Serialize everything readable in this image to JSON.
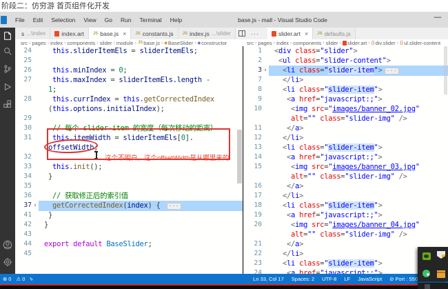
{
  "desktop": {
    "top_text": "阶段二：仿穷游 首页组件化开发"
  },
  "menu_bar": {
    "items": [
      "File",
      "Edit",
      "Selection",
      "View",
      "Go",
      "Run",
      "Terminal",
      "Help"
    ],
    "window_title": "base.js - mall - Visual Studio Code",
    "minimize_label": "—"
  },
  "tab_bar": {
    "left_tabs": [
      {
        "label": "s",
        "dir": "...\\index",
        "icon": "none",
        "state": "inactive"
      },
      {
        "label": "index.art",
        "icon": "art",
        "state": "inactive"
      },
      {
        "label": "base.js",
        "icon": "js",
        "state": "active",
        "close": "×"
      },
      {
        "label": "constants.js",
        "icon": "js",
        "state": "inactive"
      },
      {
        "label": "index.js",
        "dir": "...\\slider",
        "icon": "js",
        "state": "inactive"
      }
    ],
    "actions": {
      "more": "···"
    },
    "right_tabs": [
      {
        "label": "slider.art",
        "icon": "art",
        "state": "active",
        "close": "×"
      },
      {
        "label": "defaults.js",
        "icon": "js",
        "state": "inactive",
        "dim": true
      }
    ]
  },
  "breadcrumbs": {
    "left": [
      {
        "label": "src"
      },
      {
        "label": "pages"
      },
      {
        "label": "index"
      },
      {
        "label": "components"
      },
      {
        "label": "slider"
      },
      {
        "label": "module"
      },
      {
        "label": "base.js",
        "icon": "js"
      },
      {
        "label": "BaseSlider",
        "icon": "cls"
      },
      {
        "label": "constructor",
        "icon": "meth"
      }
    ],
    "right": [
      {
        "label": "src"
      },
      {
        "label": "pages"
      },
      {
        "label": "index"
      },
      {
        "label": "components"
      },
      {
        "label": "slider"
      },
      {
        "label": "slider.art",
        "icon": "art"
      },
      {
        "label": "div.slider",
        "icon": "tag"
      },
      {
        "label": "ul.slider-content",
        "icon": "tag"
      }
    ]
  },
  "editor_left": {
    "rows": [
      {
        "n": "24",
        "i": 2,
        "t": [
          [
            "k",
            "this"
          ],
          [
            "p",
            ".sliderItemEls"
          ],
          [
            "o",
            " = "
          ],
          [
            "v",
            "sliderItemEls"
          ],
          [
            "o",
            ";"
          ]
        ]
      },
      {
        "n": "25"
      },
      {
        "n": "26",
        "i": 2,
        "t": [
          [
            "k",
            "this"
          ],
          [
            "p",
            ".minIndex"
          ],
          [
            "o",
            " = "
          ],
          [
            "num",
            "0"
          ],
          [
            "o",
            ";"
          ]
        ]
      },
      {
        "n": "27",
        "i": 2,
        "t": [
          [
            "k",
            "this"
          ],
          [
            "p",
            ".maxIndex"
          ],
          [
            "o",
            " = "
          ],
          [
            "v",
            "sliderItemEls"
          ],
          [
            "p",
            ".length"
          ],
          [
            "o",
            " -"
          ]
        ]
      },
      {
        "n": "",
        "i": 1,
        "t": [
          [
            "num",
            "1"
          ],
          [
            "o",
            ";"
          ]
        ]
      },
      {
        "n": "28",
        "i": 2,
        "t": [
          [
            "k",
            "this"
          ],
          [
            "p",
            ".currIndex"
          ],
          [
            "o",
            " = "
          ],
          [
            "k",
            "this"
          ],
          [
            "o",
            "."
          ],
          [
            "f",
            "getCorrectedIndex"
          ]
        ]
      },
      {
        "n": "",
        "i": 1,
        "t": [
          [
            "o",
            "("
          ],
          [
            "k",
            "this"
          ],
          [
            "p",
            ".options.initialIndex"
          ],
          [
            "o",
            ");"
          ]
        ]
      },
      {
        "n": "29"
      },
      {
        "n": "30",
        "i": 2,
        "t": [
          [
            "c",
            "// 每个 slider-item 的宽度（每次移动的距离）"
          ]
        ]
      },
      {
        "n": "31",
        "i": 2,
        "t": [
          [
            "k",
            "this"
          ],
          [
            "p",
            ".itemWidth"
          ],
          [
            "o",
            " = "
          ],
          [
            "v",
            "sliderItemEls"
          ],
          [
            "o",
            "["
          ],
          [
            "num",
            "0"
          ],
          [
            "o",
            "]."
          ]
        ]
      },
      {
        "n": "",
        "i": 1,
        "t": [
          [
            "p",
            "offsetWidth"
          ],
          [
            "o",
            ";"
          ]
        ]
      },
      {
        "n": "32"
      },
      {
        "n": "33",
        "i": 2,
        "t": [
          [
            "k",
            "this"
          ],
          [
            "o",
            "."
          ],
          [
            "f",
            "init"
          ],
          [
            "o",
            "();"
          ]
        ]
      },
      {
        "n": "34",
        "i": 1,
        "t": [
          [
            "o",
            "}"
          ]
        ]
      },
      {
        "n": "35"
      },
      {
        "n": "36",
        "i": 2,
        "t": [
          [
            "c",
            "// 获取修正后的索引值"
          ]
        ]
      },
      {
        "n": "37",
        "i": 2,
        "hl": true,
        "fold": true,
        "t": [
          [
            "f",
            "getCorrectedIndex"
          ],
          [
            "o",
            "("
          ],
          [
            "v",
            "index"
          ],
          [
            "o",
            ") { "
          ],
          [
            "fd",
            "···"
          ]
        ]
      },
      {
        "n": "41",
        "i": 1,
        "t": [
          [
            "o",
            "}"
          ]
        ]
      },
      {
        "n": "42",
        "i": 0,
        "t": [
          [
            "o",
            "}"
          ]
        ]
      },
      {
        "n": "43"
      },
      {
        "n": "44",
        "i": 0,
        "t": [
          [
            "pk",
            "export"
          ],
          [
            "o",
            " "
          ],
          [
            "pk",
            "default"
          ],
          [
            "o",
            " "
          ],
          [
            "cl",
            "BaseSlider"
          ],
          [
            "o",
            ";"
          ]
        ]
      },
      {
        "n": "45"
      }
    ]
  },
  "editor_right": {
    "rows": [
      {
        "n": "1",
        "i": 0,
        "t": [
          [
            "b",
            "<"
          ],
          [
            "tag",
            "div"
          ],
          [
            "o",
            " "
          ],
          [
            "at",
            "class"
          ],
          [
            "o",
            "="
          ],
          [
            "str",
            "\"slider\""
          ],
          [
            "b",
            ">"
          ]
        ]
      },
      {
        "n": "2",
        "i": 1,
        "t": [
          [
            "b",
            "<"
          ],
          [
            "tag",
            "ul"
          ],
          [
            "o",
            " "
          ],
          [
            "at",
            "class"
          ],
          [
            "o",
            "="
          ],
          [
            "str",
            "\"slider-content\""
          ],
          [
            "b",
            ">"
          ]
        ]
      },
      {
        "n": "3",
        "i": 2,
        "hl": true,
        "fold": true,
        "t": [
          [
            "b",
            "<"
          ],
          [
            "tag",
            "li"
          ],
          [
            "o",
            " "
          ],
          [
            "at",
            "class"
          ],
          [
            "o",
            "="
          ],
          [
            "str",
            "\""
          ],
          [
            "wh",
            "slider-item"
          ],
          [
            "str",
            "\""
          ],
          [
            "b",
            ">"
          ],
          [
            "fd",
            "···"
          ]
        ]
      },
      {
        "n": "7",
        "i": 2,
        "t": [
          [
            "b",
            "</"
          ],
          [
            "tag",
            "li"
          ],
          [
            "b",
            ">"
          ]
        ]
      },
      {
        "n": "8",
        "i": 2,
        "t": [
          [
            "b",
            "<"
          ],
          [
            "tag",
            "li"
          ],
          [
            "o",
            " "
          ],
          [
            "at",
            "class"
          ],
          [
            "o",
            "="
          ],
          [
            "str",
            "\""
          ],
          [
            "wh",
            "slider-item"
          ],
          [
            "str",
            "\""
          ],
          [
            "b",
            ">"
          ]
        ]
      },
      {
        "n": "9",
        "i": 3,
        "t": [
          [
            "b",
            "<"
          ],
          [
            "tag",
            "a"
          ],
          [
            "o",
            " "
          ],
          [
            "at",
            "href"
          ],
          [
            "o",
            "="
          ],
          [
            "str",
            "\"javascript:;\""
          ],
          [
            "b",
            ">"
          ]
        ]
      },
      {
        "n": "10",
        "i": 4,
        "t": [
          [
            "b",
            "<"
          ],
          [
            "tag",
            "img"
          ],
          [
            "o",
            " "
          ],
          [
            "at",
            "src"
          ],
          [
            "o",
            "="
          ],
          [
            "str",
            "\""
          ],
          [
            "lnk",
            "images/banner_02.jpg"
          ],
          [
            "str",
            "\""
          ]
        ]
      },
      {
        "n": "",
        "i": 4,
        "t": [
          [
            "at",
            "alt"
          ],
          [
            "o",
            "="
          ],
          [
            "str",
            "\"\""
          ],
          [
            "o",
            " "
          ],
          [
            "at",
            "class"
          ],
          [
            "o",
            "="
          ],
          [
            "str",
            "\"slider-img\""
          ],
          [
            "b",
            " />"
          ]
        ]
      },
      {
        "n": "11",
        "i": 3,
        "t": [
          [
            "b",
            "</"
          ],
          [
            "tag",
            "a"
          ],
          [
            "b",
            ">"
          ]
        ]
      },
      {
        "n": "12",
        "i": 2,
        "t": [
          [
            "b",
            "</"
          ],
          [
            "tag",
            "li"
          ],
          [
            "b",
            ">"
          ]
        ]
      },
      {
        "n": "13",
        "i": 2,
        "t": [
          [
            "b",
            "<"
          ],
          [
            "tag",
            "li"
          ],
          [
            "o",
            " "
          ],
          [
            "at",
            "class"
          ],
          [
            "o",
            "="
          ],
          [
            "str",
            "\""
          ],
          [
            "wh",
            "slider-item"
          ],
          [
            "str",
            "\""
          ],
          [
            "b",
            ">"
          ]
        ]
      },
      {
        "n": "14",
        "i": 3,
        "t": [
          [
            "b",
            "<"
          ],
          [
            "tag",
            "a"
          ],
          [
            "o",
            " "
          ],
          [
            "at",
            "href"
          ],
          [
            "o",
            "="
          ],
          [
            "str",
            "\"javascript:;\""
          ],
          [
            "b",
            ">"
          ]
        ]
      },
      {
        "n": "15",
        "i": 4,
        "t": [
          [
            "b",
            "<"
          ],
          [
            "tag",
            "img"
          ],
          [
            "o",
            " "
          ],
          [
            "at",
            "src"
          ],
          [
            "o",
            "="
          ],
          [
            "str",
            "\""
          ],
          [
            "lnk",
            "images/banner_03.jpg"
          ],
          [
            "str",
            "\""
          ]
        ]
      },
      {
        "n": "",
        "i": 4,
        "t": [
          [
            "at",
            "alt"
          ],
          [
            "o",
            "="
          ],
          [
            "str",
            "\"\""
          ],
          [
            "o",
            " "
          ],
          [
            "at",
            "class"
          ],
          [
            "o",
            "="
          ],
          [
            "str",
            "\"slider-img\""
          ],
          [
            "b",
            " />"
          ]
        ]
      },
      {
        "n": "16",
        "i": 3,
        "t": [
          [
            "b",
            "</"
          ],
          [
            "tag",
            "a"
          ],
          [
            "b",
            ">"
          ]
        ]
      },
      {
        "n": "17",
        "i": 2,
        "t": [
          [
            "b",
            "</"
          ],
          [
            "tag",
            "li"
          ],
          [
            "b",
            ">"
          ]
        ]
      },
      {
        "n": "18",
        "i": 2,
        "t": [
          [
            "b",
            "<"
          ],
          [
            "tag",
            "li"
          ],
          [
            "o",
            " "
          ],
          [
            "at",
            "class"
          ],
          [
            "o",
            "="
          ],
          [
            "str",
            "\""
          ],
          [
            "wh",
            "slider-item"
          ],
          [
            "str",
            "\""
          ],
          [
            "b",
            ">"
          ]
        ]
      },
      {
        "n": "19",
        "i": 3,
        "t": [
          [
            "b",
            "<"
          ],
          [
            "tag",
            "a"
          ],
          [
            "o",
            " "
          ],
          [
            "at",
            "href"
          ],
          [
            "o",
            "="
          ],
          [
            "str",
            "\"javascript:;\""
          ],
          [
            "b",
            ">"
          ]
        ]
      },
      {
        "n": "20",
        "i": 4,
        "t": [
          [
            "b",
            "<"
          ],
          [
            "tag",
            "img"
          ],
          [
            "o",
            " "
          ],
          [
            "at",
            "src"
          ],
          [
            "o",
            "="
          ],
          [
            "str",
            "\""
          ],
          [
            "lnk",
            "images/banner_04.jpg"
          ],
          [
            "str",
            "\""
          ]
        ]
      },
      {
        "n": "",
        "i": 4,
        "t": [
          [
            "at",
            "alt"
          ],
          [
            "o",
            "="
          ],
          [
            "str",
            "\"\""
          ],
          [
            "o",
            " "
          ],
          [
            "at",
            "class"
          ],
          [
            "o",
            "="
          ],
          [
            "str",
            "\"slider-img\""
          ],
          [
            "b",
            " />"
          ]
        ]
      },
      {
        "n": "21",
        "i": 3,
        "t": [
          [
            "b",
            "</"
          ],
          [
            "tag",
            "a"
          ],
          [
            "b",
            ">"
          ]
        ]
      },
      {
        "n": "22",
        "i": 2,
        "t": [
          [
            "b",
            "</"
          ],
          [
            "tag",
            "li"
          ],
          [
            "b",
            ">"
          ]
        ]
      },
      {
        "n": "23",
        "i": 2,
        "t": [
          [
            "b",
            "<"
          ],
          [
            "tag",
            "li"
          ],
          [
            "o",
            " "
          ],
          [
            "at",
            "class"
          ],
          [
            "o",
            "="
          ],
          [
            "str",
            "\""
          ],
          [
            "wh",
            "slider-item"
          ],
          [
            "str",
            "\""
          ],
          [
            "b",
            ">"
          ]
        ]
      },
      {
        "n": "24",
        "i": 3,
        "t": [
          [
            "b",
            "<"
          ],
          [
            "tag",
            "a"
          ],
          [
            "o",
            " "
          ],
          [
            "at",
            "href"
          ],
          [
            "o",
            "="
          ],
          [
            "str",
            "\"javascript:;\""
          ],
          [
            "b",
            ">"
          ]
        ]
      }
    ]
  },
  "annotation": {
    "note": "这个不明白，这个offsetWidth是从哪里来的"
  },
  "status_bar": {
    "left": [
      {
        "icon": "error-icon",
        "glyph": "⊗",
        "text": "0"
      },
      {
        "icon": "warning-icon",
        "glyph": "⚠",
        "text": "0"
      },
      {
        "icon": "bolt-icon",
        "glyph": "ϟ",
        "text": ""
      }
    ],
    "right": [
      {
        "text": "Ln 33, Col 17"
      },
      {
        "text": "Spaces: 2"
      },
      {
        "text": "UTF-8"
      },
      {
        "text": "LF"
      },
      {
        "text": "JavaScript"
      },
      {
        "glyph": "⊘",
        "text": "Port : 550"
      }
    ]
  },
  "tray": {
    "icons": [
      "nvidia-icon",
      "defender-shield-icon",
      "green-app-icon",
      "orange-file-icon",
      "tray-mini-icon"
    ]
  },
  "colors": {
    "statusbar_blue": "#0f74cd",
    "annotation_red": "#e03131",
    "selection_highlight": "#add6ff",
    "activity_bar": "#333333"
  }
}
